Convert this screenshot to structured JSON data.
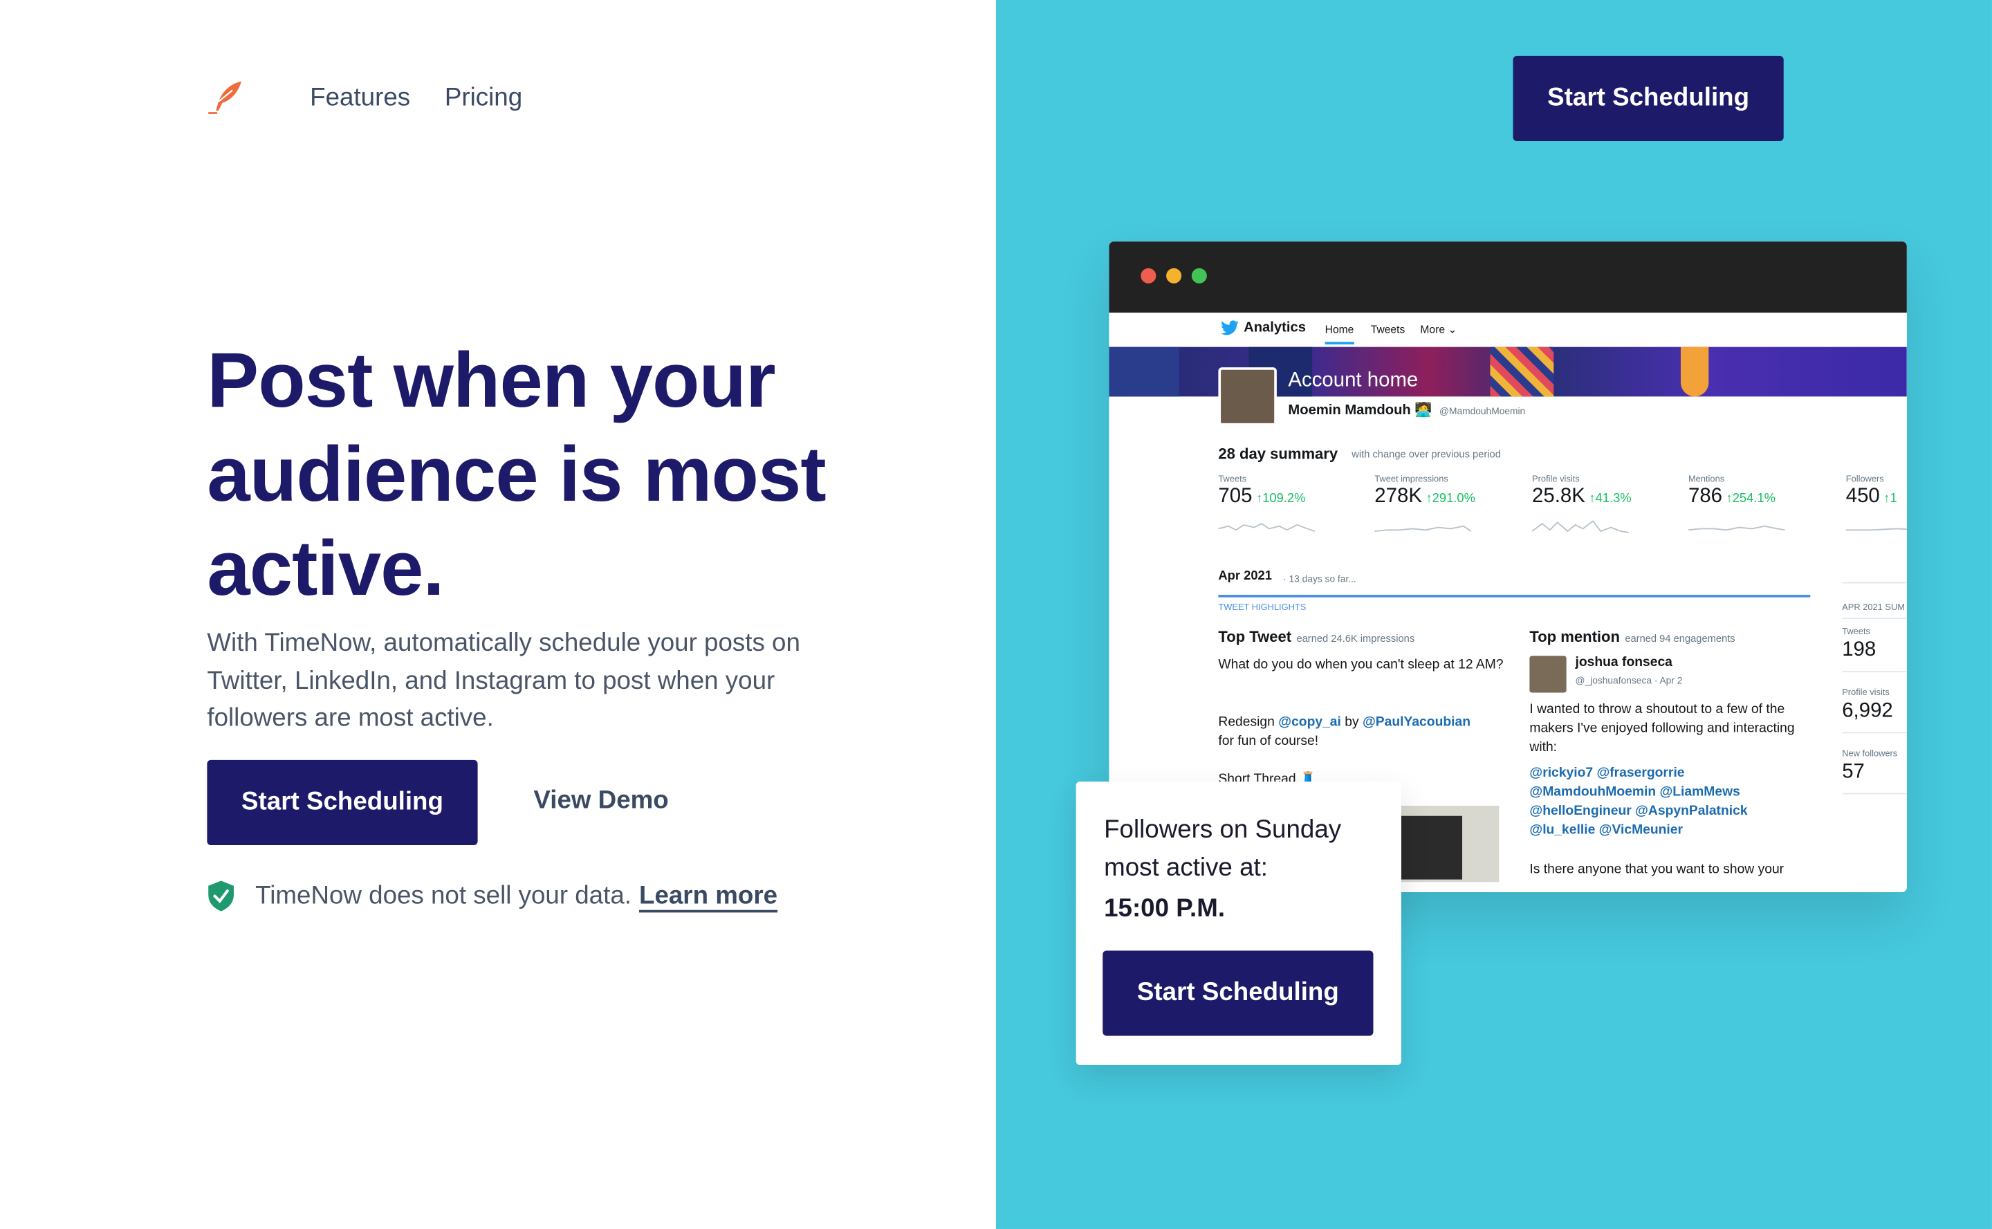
{
  "nav": {
    "features": "Features",
    "pricing": "Pricing",
    "cta": "Start Scheduling"
  },
  "hero": {
    "headline": "Post when your audience is most active.",
    "lead": "With TimeNow, automatically schedule your posts on Twitter, LinkedIn, and Instagram to post when your followers are most active.",
    "cta_primary": "Start Scheduling",
    "cta_demo": "View Demo",
    "privacy_text": "TimeNow does not sell your data.",
    "privacy_link": "Learn more"
  },
  "colors": {
    "navy": "#1e1a6a",
    "cyan_panel": "#46c8dd",
    "logo_orange": "#ee6b3c",
    "shield_green": "#1f9a6f"
  },
  "analytics": {
    "brand": "Analytics",
    "tabs": [
      "Home",
      "Tweets",
      "More"
    ],
    "account_home": "Account home",
    "name": "Moemin Mamdouh 🧑‍💻",
    "handle": "@MamdouhMoemin",
    "summary_title": "28 day summary",
    "summary_sub": "with change over previous period",
    "stats": [
      {
        "label": "Tweets",
        "value": "705",
        "change": "↑109.2%"
      },
      {
        "label": "Tweet impressions",
        "value": "278K",
        "change": "↑291.0%"
      },
      {
        "label": "Profile visits",
        "value": "25.8K",
        "change": "↑41.3%"
      },
      {
        "label": "Mentions",
        "value": "786",
        "change": "↑254.1%"
      },
      {
        "label": "Followers",
        "value": "450",
        "change": "↑1"
      }
    ],
    "month": "Apr 2021",
    "month_sub": "· 13 days so far...",
    "highlights": "TWEET HIGHLIGHTS",
    "top_tweet_title": "Top Tweet",
    "top_tweet_sub": "earned 24.6K impressions",
    "top_tweet_text": "What do you do when you can't sleep at 12 AM?",
    "top_tweet_redesign": "Redesign",
    "top_tweet_m1": "@copy_ai",
    "top_tweet_by": "by",
    "top_tweet_m2": "@PaulYacoubian",
    "top_tweet_fun": "for fun of course!",
    "top_tweet_thread": "Short Thread 🧵",
    "top_mention_title": "Top mention",
    "top_mention_sub": "earned 94 engagements",
    "mention_name": "joshua fonseca",
    "mention_handle": "@_joshuafonseca · Apr 2",
    "mention_text": "I wanted to throw a shoutout to a few of the makers I've enjoyed following and interacting with:",
    "mention_users_1": "@rickyio7 @frasergorrie",
    "mention_users_2": "@MamdouhMoemin @LiamMews",
    "mention_users_3": "@helloEngineur @AspynPalatnick",
    "mention_users_4": "@lu_kellie @VicMeunier",
    "mention_more": "Is there anyone that you want to show your",
    "side_title": "APR 2021 SUM",
    "side": [
      {
        "label": "Tweets",
        "value": "198"
      },
      {
        "label": "Profile visits",
        "value": "6,992"
      },
      {
        "label": "New followers",
        "value": "57"
      }
    ]
  },
  "card": {
    "line": "Followers on Sunday most active at:",
    "time": "15:00 P.M.",
    "cta": "Start Scheduling"
  }
}
